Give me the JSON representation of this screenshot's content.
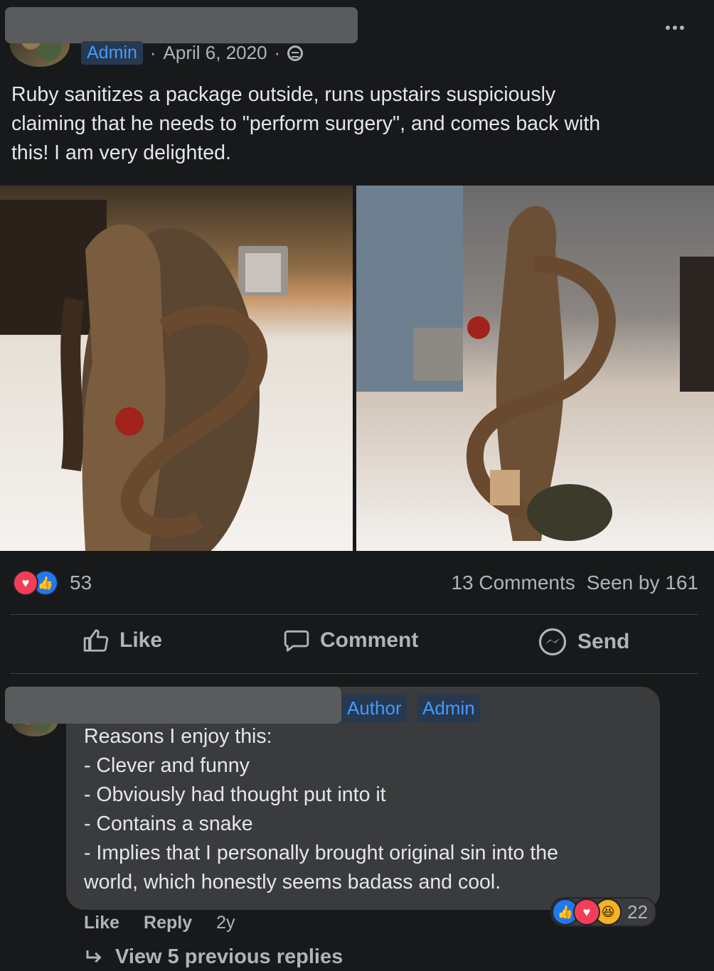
{
  "post": {
    "role_badge": "Admin",
    "date": "April 6, 2020",
    "separator": "·",
    "visibility_icon": "group-icon",
    "body": "Ruby sanitizes a package outside, runs upstairs suspiciously\nclaiming that he needs to \"perform surgery\", and comes back with\nthis! I am very delighted.",
    "photos": [
      "bronze-eve-statue-photo-1",
      "bronze-eve-statue-photo-2"
    ]
  },
  "stats": {
    "reaction_count": "53",
    "reaction_icons": [
      "heart-reaction-icon",
      "like-reaction-icon"
    ],
    "comments": "13 Comments",
    "seen": "Seen by 161"
  },
  "actions": {
    "like": "Like",
    "comment": "Comment",
    "send": "Send"
  },
  "comment": {
    "tags": [
      "Author",
      "Admin"
    ],
    "lines": [
      "Reasons I enjoy this:",
      "- Clever and funny",
      "- Obviously had thought put into it",
      "- Contains a snake",
      "- Implies that I personally brought original sin into the",
      "world, which honestly seems badass and cool."
    ],
    "reaction_count": "22",
    "reaction_icons": [
      "like-reaction-icon",
      "heart-reaction-icon",
      "haha-reaction-icon"
    ],
    "like": "Like",
    "reply": "Reply",
    "age": "2y",
    "view_replies": "View 5 previous replies"
  },
  "colors": {
    "background": "#18191a",
    "accent": "#4599ff",
    "bubble": "#3a3b3c"
  }
}
